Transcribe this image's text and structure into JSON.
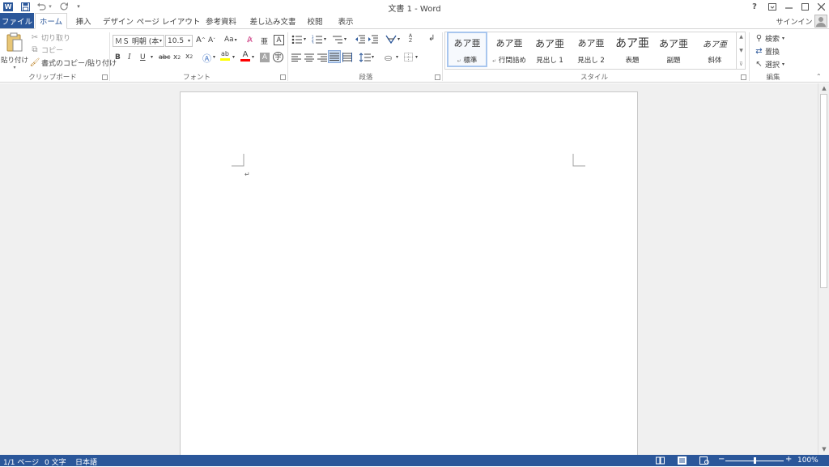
{
  "window": {
    "title": "文書 1 - Word",
    "help": "?",
    "signin": "サインイン"
  },
  "quick_access": {
    "word_icon": "W",
    "save_icon": "save-icon",
    "undo_icon": "undo-icon",
    "redo_icon": "redo-icon",
    "more": "▾"
  },
  "tabs": [
    "ファイル",
    "ホーム",
    "挿入",
    "デザイン",
    "ページ レイアウト",
    "参考資料",
    "差し込み文書",
    "校閲",
    "表示"
  ],
  "active_tab": "ホーム",
  "clipboard": {
    "paste": "貼り付け",
    "cut": "切り取り",
    "copy": "コピー",
    "format_painter": "書式のコピー/貼り付け",
    "label": "クリップボード"
  },
  "font": {
    "name": "ＭＳ 明朝 (本",
    "size": "10.5",
    "label": "フォント",
    "aa": "Aa"
  },
  "paragraph": {
    "label": "段落"
  },
  "styles": {
    "label": "スタイル",
    "items": [
      {
        "preview": "あア亜",
        "name": "標準",
        "mark": "↵"
      },
      {
        "preview": "あア亜",
        "name": "行間詰め",
        "mark": "↵"
      },
      {
        "preview": "あア亜",
        "name": "見出し 1",
        "mark": ""
      },
      {
        "preview": "あア亜",
        "name": "見出し 2",
        "mark": ""
      },
      {
        "preview": "あア亜",
        "name": "表題",
        "mark": ""
      },
      {
        "preview": "あア亜",
        "name": "副題",
        "mark": ""
      },
      {
        "preview": "あア亜",
        "name": "斜体",
        "mark": ""
      }
    ]
  },
  "editing": {
    "find": "検索",
    "replace": "置換",
    "select": "選択",
    "label": "編集"
  },
  "document": {
    "paragraph_mark": "↵"
  },
  "status": {
    "page": "1/1 ページ",
    "words": "0 文字",
    "language": "日本語",
    "zoom": "100%",
    "zoom_level": 1.0
  },
  "colors": {
    "accent": "#2b579a",
    "highlight": "#ffff00",
    "font_color": "#ff0000"
  }
}
